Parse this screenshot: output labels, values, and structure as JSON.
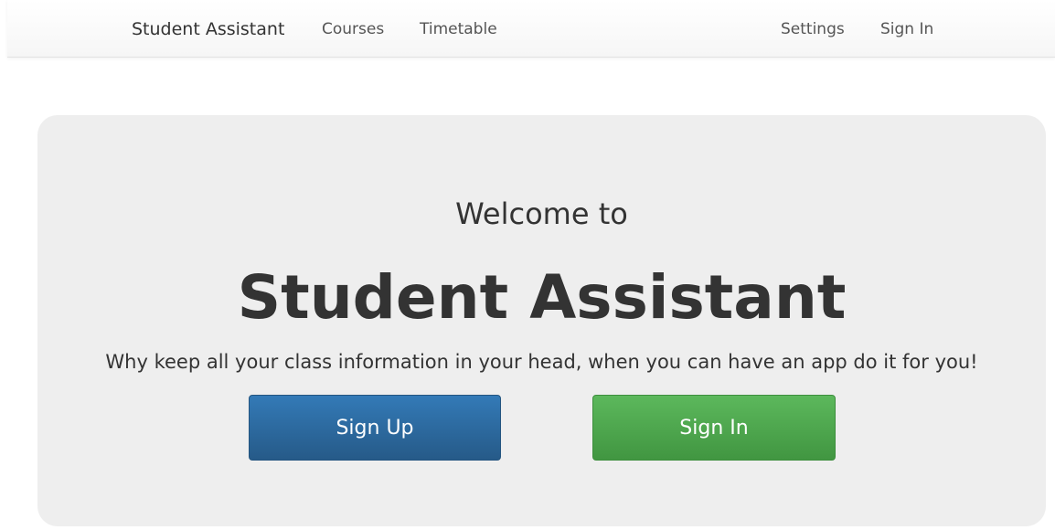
{
  "navbar": {
    "brand": "Student Assistant",
    "left_links": [
      "Courses",
      "Timetable"
    ],
    "right_links": [
      "Settings",
      "Sign In"
    ]
  },
  "hero": {
    "welcome": "Welcome to",
    "title": "Student Assistant",
    "tagline": "Why keep all your class information in your head, when you can have an app do it for you!",
    "signup_label": "Sign Up",
    "signin_label": "Sign In"
  },
  "colors": {
    "primary": "#337ab7",
    "success": "#5cb85c",
    "jumbotron_bg": "#eeeeee"
  }
}
